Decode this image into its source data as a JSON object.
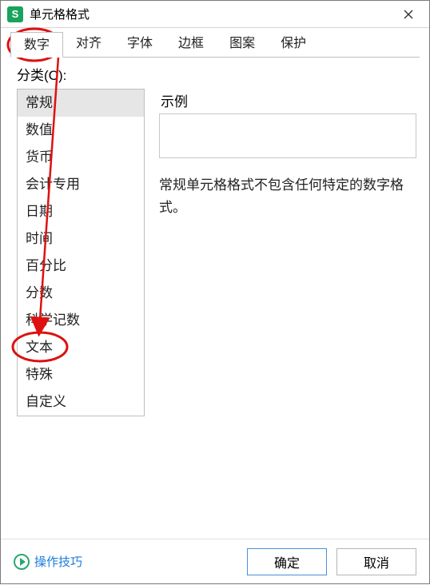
{
  "window": {
    "title": "单元格格式",
    "icon_letter": "S"
  },
  "tabs": [
    {
      "label": "数字",
      "active": true
    },
    {
      "label": "对齐",
      "active": false
    },
    {
      "label": "字体",
      "active": false
    },
    {
      "label": "边框",
      "active": false
    },
    {
      "label": "图案",
      "active": false
    },
    {
      "label": "保护",
      "active": false
    }
  ],
  "category_label": "分类(C):",
  "categories": [
    "常规",
    "数值",
    "货币",
    "会计专用",
    "日期",
    "时间",
    "百分比",
    "分数",
    "科学记数",
    "文本",
    "特殊",
    "自定义"
  ],
  "selected_category_index": 0,
  "sample": {
    "label": "示例",
    "value": ""
  },
  "description": "常规单元格格式不包含任何特定的数字格式。",
  "footer": {
    "tips": "操作技巧",
    "ok": "确定",
    "cancel": "取消"
  },
  "annotation": {
    "circled_tab_index": 0,
    "circled_category_index": 9,
    "circled_category_label": "文本"
  }
}
